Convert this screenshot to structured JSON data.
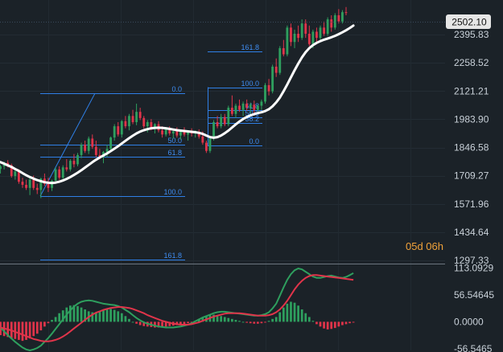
{
  "colors": {
    "background": "#1b2228",
    "bull": "#2e9f5e",
    "bear": "#e0344a",
    "ma": "#ffffff",
    "fib": "#2f7fe6",
    "fib_text": "#3f8cf0",
    "macd_line": "#2e9f5e",
    "signal_line": "#e0344a",
    "price_box_bg": "#e6e6e6",
    "timer": "#f0a23a"
  },
  "countdown": "05d 06h",
  "chart_data": {
    "type": "candlestick",
    "price_axis": {
      "ticks": [
        "2395.83",
        "2258.52",
        "2121.21",
        "1983.90",
        "1846.58",
        "1709.27",
        "1571.96",
        "1434.64",
        "1297.33"
      ],
      "last_price": "2502.10",
      "range": [
        1297.33,
        2533
      ]
    },
    "indicator_axis": {
      "ticks": [
        "113.0929",
        "56.54645",
        "0.0000",
        "-56.5465"
      ],
      "range": [
        -60,
        117
      ]
    },
    "candles": [
      {
        "o": 1780,
        "h": 1795,
        "l": 1728,
        "c": 1740
      },
      {
        "o": 1742,
        "h": 1762,
        "l": 1720,
        "c": 1755
      },
      {
        "o": 1755,
        "h": 1778,
        "l": 1740,
        "c": 1770
      },
      {
        "o": 1772,
        "h": 1785,
        "l": 1750,
        "c": 1760
      },
      {
        "o": 1760,
        "h": 1768,
        "l": 1700,
        "c": 1708
      },
      {
        "o": 1708,
        "h": 1735,
        "l": 1690,
        "c": 1730
      },
      {
        "o": 1730,
        "h": 1740,
        "l": 1670,
        "c": 1680
      },
      {
        "o": 1680,
        "h": 1700,
        "l": 1650,
        "c": 1665
      },
      {
        "o": 1665,
        "h": 1690,
        "l": 1640,
        "c": 1650
      },
      {
        "o": 1650,
        "h": 1700,
        "l": 1615,
        "c": 1690
      },
      {
        "o": 1690,
        "h": 1710,
        "l": 1640,
        "c": 1650
      },
      {
        "o": 1650,
        "h": 1670,
        "l": 1620,
        "c": 1640
      },
      {
        "o": 1640,
        "h": 1700,
        "l": 1600,
        "c": 1695
      },
      {
        "o": 1695,
        "h": 1720,
        "l": 1660,
        "c": 1670
      },
      {
        "o": 1670,
        "h": 1700,
        "l": 1630,
        "c": 1650
      },
      {
        "o": 1650,
        "h": 1690,
        "l": 1635,
        "c": 1685
      },
      {
        "o": 1685,
        "h": 1750,
        "l": 1670,
        "c": 1740
      },
      {
        "o": 1740,
        "h": 1755,
        "l": 1690,
        "c": 1700
      },
      {
        "o": 1700,
        "h": 1760,
        "l": 1690,
        "c": 1750
      },
      {
        "o": 1750,
        "h": 1790,
        "l": 1730,
        "c": 1740
      },
      {
        "o": 1740,
        "h": 1790,
        "l": 1730,
        "c": 1782
      },
      {
        "o": 1782,
        "h": 1815,
        "l": 1750,
        "c": 1765
      },
      {
        "o": 1765,
        "h": 1820,
        "l": 1755,
        "c": 1810
      },
      {
        "o": 1810,
        "h": 1870,
        "l": 1795,
        "c": 1860
      },
      {
        "o": 1860,
        "h": 1880,
        "l": 1820,
        "c": 1830
      },
      {
        "o": 1830,
        "h": 1900,
        "l": 1815,
        "c": 1890
      },
      {
        "o": 1890,
        "h": 1910,
        "l": 1840,
        "c": 1850
      },
      {
        "o": 1850,
        "h": 1880,
        "l": 1800,
        "c": 1810
      },
      {
        "o": 1810,
        "h": 1840,
        "l": 1790,
        "c": 1800
      },
      {
        "o": 1800,
        "h": 1830,
        "l": 1770,
        "c": 1825
      },
      {
        "o": 1825,
        "h": 1860,
        "l": 1800,
        "c": 1840
      },
      {
        "o": 1840,
        "h": 1900,
        "l": 1830,
        "c": 1895
      },
      {
        "o": 1895,
        "h": 1960,
        "l": 1880,
        "c": 1950
      },
      {
        "o": 1950,
        "h": 1970,
        "l": 1900,
        "c": 1910
      },
      {
        "o": 1910,
        "h": 1980,
        "l": 1895,
        "c": 1975
      },
      {
        "o": 1975,
        "h": 2000,
        "l": 1940,
        "c": 1950
      },
      {
        "o": 1950,
        "h": 2010,
        "l": 1930,
        "c": 2000
      },
      {
        "o": 2000,
        "h": 2030,
        "l": 1960,
        "c": 1970
      },
      {
        "o": 1970,
        "h": 2060,
        "l": 1955,
        "c": 2020
      },
      {
        "o": 2020,
        "h": 2040,
        "l": 1980,
        "c": 1990
      },
      {
        "o": 1990,
        "h": 2000,
        "l": 1940,
        "c": 1950
      },
      {
        "o": 1950,
        "h": 1980,
        "l": 1920,
        "c": 1970
      },
      {
        "o": 1970,
        "h": 1985,
        "l": 1930,
        "c": 1940
      },
      {
        "o": 1940,
        "h": 1965,
        "l": 1915,
        "c": 1960
      },
      {
        "o": 1960,
        "h": 1975,
        "l": 1920,
        "c": 1930
      },
      {
        "o": 1930,
        "h": 1950,
        "l": 1895,
        "c": 1910
      },
      {
        "o": 1910,
        "h": 1945,
        "l": 1900,
        "c": 1935
      },
      {
        "o": 1935,
        "h": 1950,
        "l": 1905,
        "c": 1915
      },
      {
        "o": 1915,
        "h": 1935,
        "l": 1890,
        "c": 1925
      },
      {
        "o": 1925,
        "h": 1945,
        "l": 1895,
        "c": 1905
      },
      {
        "o": 1905,
        "h": 1935,
        "l": 1885,
        "c": 1930
      },
      {
        "o": 1930,
        "h": 1945,
        "l": 1900,
        "c": 1910
      },
      {
        "o": 1910,
        "h": 1930,
        "l": 1880,
        "c": 1925
      },
      {
        "o": 1925,
        "h": 1940,
        "l": 1900,
        "c": 1915
      },
      {
        "o": 1915,
        "h": 1930,
        "l": 1895,
        "c": 1920
      },
      {
        "o": 1920,
        "h": 1935,
        "l": 1890,
        "c": 1900
      },
      {
        "o": 1900,
        "h": 1925,
        "l": 1860,
        "c": 1870
      },
      {
        "o": 1870,
        "h": 1880,
        "l": 1820,
        "c": 1830
      },
      {
        "o": 1830,
        "h": 1900,
        "l": 1820,
        "c": 1890
      },
      {
        "o": 1890,
        "h": 1980,
        "l": 1880,
        "c": 1970
      },
      {
        "o": 1970,
        "h": 2000,
        "l": 1940,
        "c": 1950
      },
      {
        "o": 1950,
        "h": 2010,
        "l": 1940,
        "c": 1995
      },
      {
        "o": 1995,
        "h": 2010,
        "l": 1950,
        "c": 1960
      },
      {
        "o": 1960,
        "h": 2050,
        "l": 1950,
        "c": 2040
      },
      {
        "o": 2040,
        "h": 2100,
        "l": 2000,
        "c": 2010
      },
      {
        "o": 2010,
        "h": 2060,
        "l": 1990,
        "c": 2050
      },
      {
        "o": 2050,
        "h": 2080,
        "l": 2020,
        "c": 2030
      },
      {
        "o": 2030,
        "h": 2070,
        "l": 2000,
        "c": 2060
      },
      {
        "o": 2060,
        "h": 2080,
        "l": 2025,
        "c": 2040
      },
      {
        "o": 2040,
        "h": 2065,
        "l": 2010,
        "c": 2055
      },
      {
        "o": 2055,
        "h": 2075,
        "l": 2015,
        "c": 2030
      },
      {
        "o": 2030,
        "h": 2055,
        "l": 2010,
        "c": 2050
      },
      {
        "o": 2050,
        "h": 2080,
        "l": 2030,
        "c": 2070
      },
      {
        "o": 2070,
        "h": 2160,
        "l": 2060,
        "c": 2150
      },
      {
        "o": 2150,
        "h": 2180,
        "l": 2100,
        "c": 2120
      },
      {
        "o": 2120,
        "h": 2250,
        "l": 2110,
        "c": 2240
      },
      {
        "o": 2240,
        "h": 2280,
        "l": 2190,
        "c": 2210
      },
      {
        "o": 2210,
        "h": 2340,
        "l": 2200,
        "c": 2330
      },
      {
        "o": 2330,
        "h": 2370,
        "l": 2290,
        "c": 2300
      },
      {
        "o": 2300,
        "h": 2440,
        "l": 2290,
        "c": 2430
      },
      {
        "o": 2430,
        "h": 2450,
        "l": 2340,
        "c": 2360
      },
      {
        "o": 2360,
        "h": 2420,
        "l": 2330,
        "c": 2400
      },
      {
        "o": 2400,
        "h": 2440,
        "l": 2360,
        "c": 2380
      },
      {
        "o": 2380,
        "h": 2470,
        "l": 2370,
        "c": 2450
      },
      {
        "o": 2450,
        "h": 2470,
        "l": 2380,
        "c": 2400
      },
      {
        "o": 2400,
        "h": 2440,
        "l": 2340,
        "c": 2350
      },
      {
        "o": 2350,
        "h": 2420,
        "l": 2330,
        "c": 2410
      },
      {
        "o": 2410,
        "h": 2430,
        "l": 2360,
        "c": 2380
      },
      {
        "o": 2380,
        "h": 2440,
        "l": 2370,
        "c": 2430
      },
      {
        "o": 2430,
        "h": 2460,
        "l": 2390,
        "c": 2400
      },
      {
        "o": 2400,
        "h": 2480,
        "l": 2390,
        "c": 2470
      },
      {
        "o": 2470,
        "h": 2490,
        "l": 2410,
        "c": 2430
      },
      {
        "o": 2430,
        "h": 2500,
        "l": 2420,
        "c": 2490
      },
      {
        "o": 2490,
        "h": 2520,
        "l": 2450,
        "c": 2460
      },
      {
        "o": 2460,
        "h": 2515,
        "l": 2450,
        "c": 2505
      },
      {
        "o": 2505,
        "h": 2530,
        "l": 2490,
        "c": 2502
      }
    ],
    "moving_average": [
      1780,
      1775,
      1768,
      1760,
      1752,
      1742,
      1733,
      1722,
      1712,
      1703,
      1695,
      1688,
      1683,
      1678,
      1675,
      1674,
      1676,
      1680,
      1686,
      1694,
      1703,
      1713,
      1724,
      1736,
      1749,
      1762,
      1775,
      1787,
      1798,
      1808,
      1818,
      1829,
      1841,
      1853,
      1866,
      1879,
      1892,
      1904,
      1915,
      1924,
      1931,
      1936,
      1940,
      1942,
      1943,
      1942,
      1940,
      1937,
      1934,
      1931,
      1929,
      1927,
      1925,
      1923,
      1921,
      1918,
      1913,
      1905,
      1897,
      1894,
      1897,
      1905,
      1916,
      1929,
      1944,
      1959,
      1973,
      1985,
      1995,
      2003,
      2009,
      2014,
      2018,
      2024,
      2033,
      2047,
      2066,
      2090,
      2120,
      2153,
      2188,
      2222,
      2255,
      2285,
      2310,
      2330,
      2345,
      2356,
      2364,
      2371,
      2377,
      2383,
      2390,
      2398,
      2407,
      2417,
      2428,
      2440
    ],
    "fibonacci_retracements": [
      {
        "levels": [
          {
            "label": "0.0",
            "value": 2110
          },
          {
            "label": "50.0",
            "value": 1860
          },
          {
            "label": "61.8",
            "value": 1800
          },
          {
            "label": "100.0",
            "value": 1610
          },
          {
            "label": "161.8",
            "value": 1300
          }
        ]
      },
      {
        "levels": [
          {
            "label": "161.8",
            "value": 2315
          },
          {
            "label": "100.0",
            "value": 2140
          },
          {
            "label": "61.8",
            "value": 2030
          },
          {
            "label": "50.0",
            "value": 1995
          },
          {
            "label": "38.2",
            "value": 1965
          },
          {
            "label": "0.0",
            "value": 1855
          }
        ]
      }
    ],
    "macd": {
      "histogram": [
        -25,
        -28,
        -30,
        -32,
        -35,
        -36,
        -38,
        -40,
        -38,
        -35,
        -30,
        -25,
        -18,
        -10,
        -3,
        4,
        10,
        18,
        24,
        30,
        34,
        35,
        33,
        30,
        26,
        22,
        20,
        20,
        22,
        24,
        26,
        27,
        25,
        22,
        18,
        12,
        6,
        0,
        -4,
        -7,
        -9,
        -10,
        -11,
        -12,
        -12,
        -11,
        -10,
        -9,
        -8,
        -7,
        -6,
        -5,
        -3,
        -1,
        2,
        6,
        9,
        12,
        14,
        15,
        14,
        12,
        10,
        8,
        6,
        4,
        2,
        0,
        -2,
        -3,
        -4,
        -4,
        -3,
        -1,
        2,
        6,
        10,
        20,
        30,
        38,
        42,
        40,
        34,
        26,
        18,
        10,
        2,
        -5,
        -10,
        -14,
        -16,
        -15,
        -13,
        -10,
        -7,
        -5,
        -3,
        -1
      ],
      "macd_line": [
        -5,
        -12,
        -20,
        -28,
        -35,
        -42,
        -48,
        -54,
        -58,
        -60,
        -58,
        -55,
        -50,
        -42,
        -34,
        -25,
        -15,
        -5,
        5,
        15,
        24,
        32,
        38,
        42,
        44,
        45,
        44,
        42,
        40,
        38,
        37,
        36,
        35,
        33,
        30,
        25,
        20,
        14,
        8,
        3,
        -1,
        -4,
        -6,
        -8,
        -10,
        -11,
        -12,
        -12,
        -12,
        -11,
        -10,
        -8,
        -6,
        -3,
        1,
        5,
        9,
        12,
        15,
        18,
        20,
        21,
        21,
        20,
        19,
        18,
        17,
        16,
        15,
        14,
        13,
        13,
        14,
        16,
        20,
        28,
        38,
        55,
        72,
        88,
        100,
        108,
        112,
        110,
        105,
        100,
        95,
        92,
        92,
        94,
        96,
        97,
        95,
        93,
        92,
        94,
        98,
        102
      ],
      "signal_line": [
        -10,
        -12,
        -14,
        -16,
        -18,
        -21,
        -24,
        -27,
        -30,
        -33,
        -36,
        -38,
        -40,
        -41,
        -41,
        -40,
        -38,
        -35,
        -31,
        -26,
        -20,
        -14,
        -8,
        -2,
        4,
        10,
        15,
        19,
        22,
        25,
        27,
        29,
        30,
        31,
        31,
        30,
        29,
        27,
        24,
        21,
        18,
        14,
        11,
        8,
        5,
        2,
        0,
        -2,
        -4,
        -5,
        -6,
        -6,
        -6,
        -5,
        -3,
        -1,
        2,
        5,
        8,
        11,
        13,
        15,
        17,
        18,
        18,
        18,
        18,
        17,
        16,
        15,
        14,
        13,
        13,
        13,
        14,
        16,
        20,
        26,
        34,
        44,
        56,
        68,
        78,
        86,
        92,
        96,
        98,
        98,
        97,
        96,
        95,
        94,
        93,
        92,
        91,
        90,
        89,
        88
      ]
    }
  }
}
